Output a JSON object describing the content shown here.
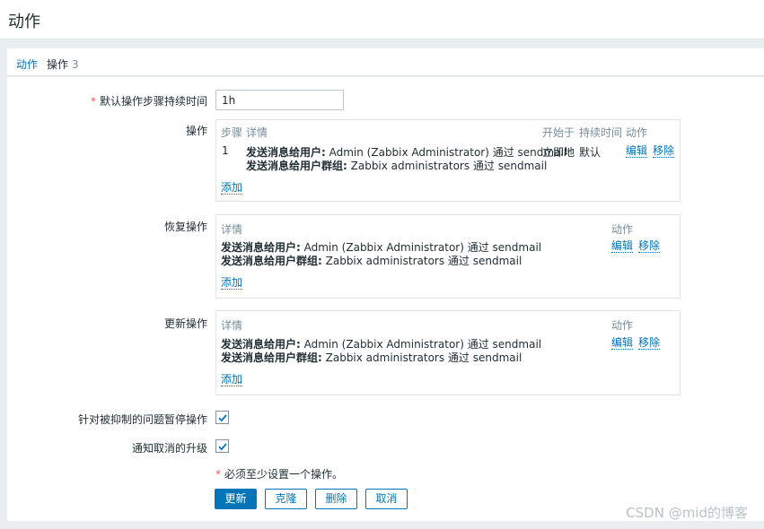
{
  "header": {
    "title": "动作"
  },
  "tabs": [
    {
      "label": "动作"
    },
    {
      "label": "操作",
      "count": "3"
    }
  ],
  "form": {
    "duration_label": "默认操作步骤持续时间",
    "duration_value": "1h",
    "operations": {
      "label": "操作",
      "headers": {
        "step": "步骤",
        "details": "详情",
        "start": "开始于",
        "duration": "持续时间",
        "action": "动作"
      },
      "rows": [
        {
          "step": "1",
          "line1_bold": "发送消息给用户:",
          "line1_rest": " Admin (Zabbix Administrator) 通过 sendmail",
          "line2_bold": "发送消息给用户群组:",
          "line2_rest": " Zabbix administrators 通过 sendmail",
          "start": "立即地",
          "duration": "默认",
          "edit": "编辑",
          "remove": "移除"
        }
      ],
      "add": "添加"
    },
    "recovery": {
      "label": "恢复操作",
      "headers": {
        "details": "详情",
        "action": "动作"
      },
      "line1_bold": "发送消息给用户:",
      "line1_rest": " Admin (Zabbix Administrator) 通过 sendmail",
      "line2_bold": "发送消息给用户群组:",
      "line2_rest": " Zabbix administrators 通过 sendmail",
      "edit": "编辑",
      "remove": "移除",
      "add": "添加"
    },
    "update": {
      "label": "更新操作",
      "headers": {
        "details": "详情",
        "action": "动作"
      },
      "line1_bold": "发送消息给用户:",
      "line1_rest": " Admin (Zabbix Administrator) 通过 sendmail",
      "line2_bold": "发送消息给用户群组:",
      "line2_rest": " Zabbix administrators 通过 sendmail",
      "edit": "编辑",
      "remove": "移除",
      "add": "添加"
    },
    "pause_suppressed_label": "针对被抑制的问题暂停操作",
    "pause_suppressed_checked": true,
    "notify_canceled_label": "通知取消的升级",
    "notify_canceled_checked": true,
    "required_note": "必须至少设置一个操作。",
    "buttons": {
      "update": "更新",
      "clone": "克隆",
      "delete": "删除",
      "cancel": "取消"
    }
  },
  "colors": {
    "accent": "#0275b8",
    "required": "#e45959"
  },
  "watermark": "CSDN @mid的博客"
}
